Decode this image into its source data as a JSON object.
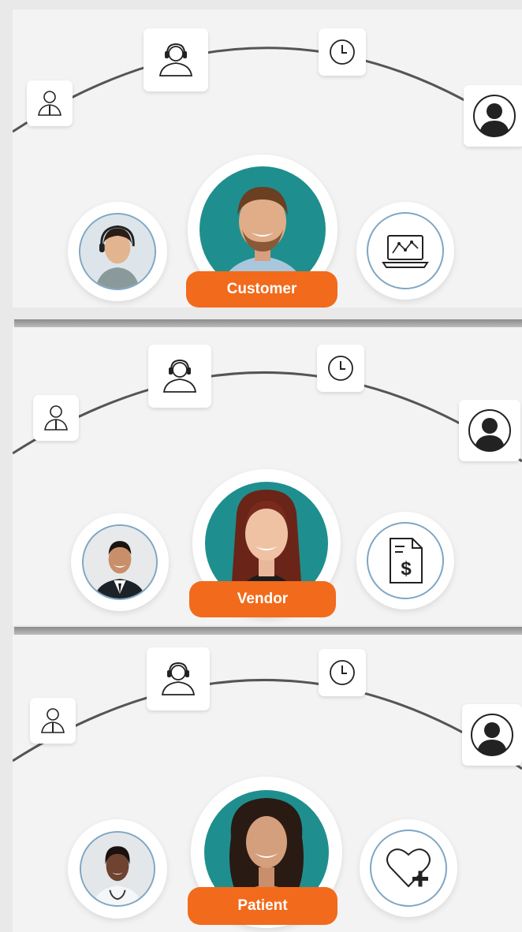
{
  "panels": [
    {
      "label": "Customer",
      "left_icon": "agent-headset-photo",
      "right_icon": "laptop-chart-icon",
      "center_photo": "man-smiling-photo"
    },
    {
      "label": "Vendor",
      "left_icon": "businessman-photo",
      "right_icon": "invoice-dollar-icon",
      "center_photo": "woman-red-hair-photo"
    },
    {
      "label": "Patient",
      "left_icon": "doctor-photo",
      "right_icon": "heart-plus-icon",
      "center_photo": "woman-curly-hair-photo"
    }
  ],
  "arc_icons": [
    "person-outline-icon",
    "headset-agent-icon",
    "clock-icon",
    "person-silhouette-icon"
  ],
  "colors": {
    "accent_orange": "#f26a1b",
    "teal": "#1e8f8e",
    "ring_blue": "#7fa6c4"
  }
}
